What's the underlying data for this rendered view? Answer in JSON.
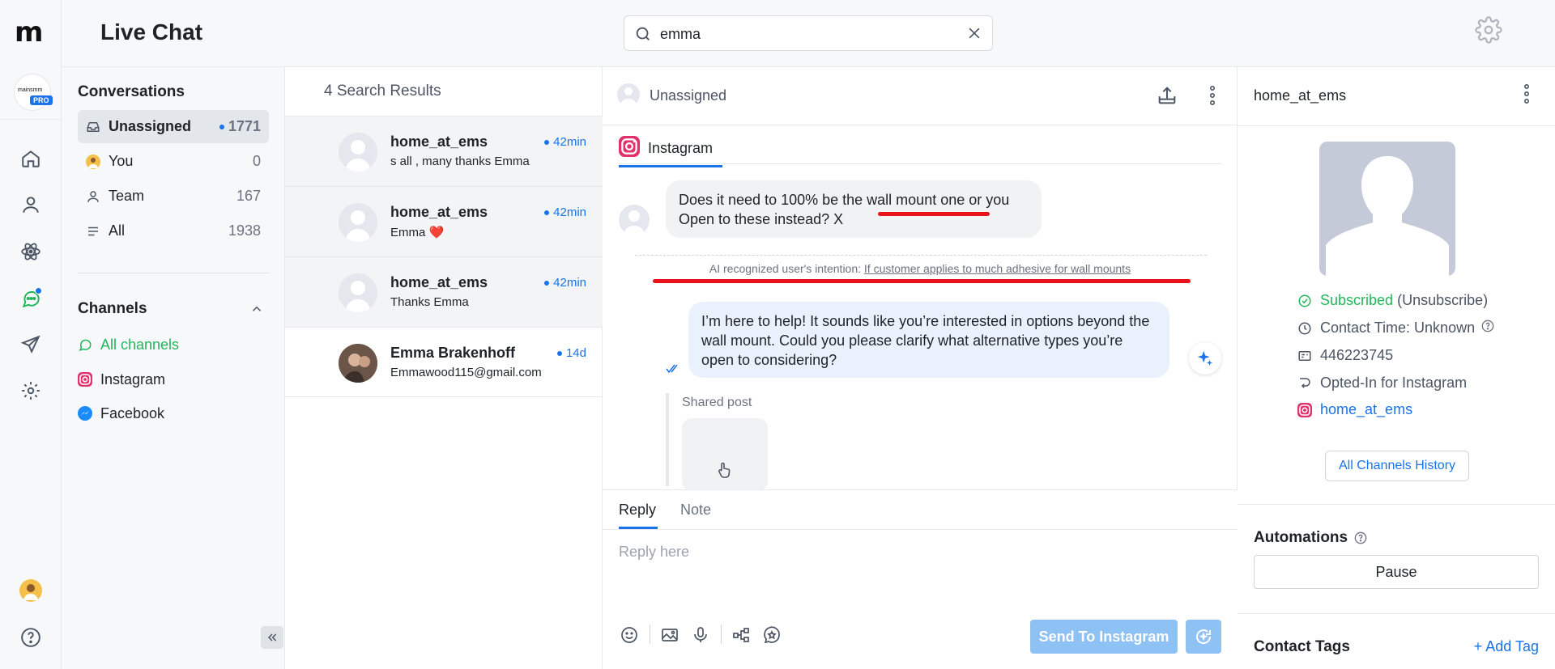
{
  "app": {
    "page_title": "Live Chat",
    "logo_text": "m",
    "account_small_text": "mainsmm",
    "plan_badge": "PRO"
  },
  "search": {
    "value": "emma",
    "placeholder": "Search"
  },
  "sidebar": {
    "conversations_title": "Conversations",
    "items": [
      {
        "label": "Unassigned",
        "count": "1771",
        "icon": "inbox-icon"
      },
      {
        "label": "You",
        "count": "0",
        "icon": "avatar"
      },
      {
        "label": "Team",
        "count": "167",
        "icon": "person-icon"
      },
      {
        "label": "All",
        "count": "1938",
        "icon": "list-icon"
      }
    ],
    "channels_title": "Channels",
    "channels": [
      {
        "label": "All channels",
        "icon": "chat-icon"
      },
      {
        "label": "Instagram",
        "icon": "instagram-icon"
      },
      {
        "label": "Facebook",
        "icon": "messenger-icon"
      }
    ]
  },
  "results": {
    "title": "4 Search Results",
    "items": [
      {
        "name": "home_at_ems",
        "time": "42min",
        "preview": "s all , many thanks Emma"
      },
      {
        "name": "home_at_ems",
        "time": "42min",
        "preview": "Emma ❤️"
      },
      {
        "name": "home_at_ems",
        "time": "42min",
        "preview": "Thanks Emma"
      },
      {
        "name": "Emma Brakenhoff",
        "time": "14d",
        "preview": "Emmawood115@gmail.com"
      }
    ]
  },
  "chat": {
    "assignee": "Unassigned",
    "channel_tab": "Instagram",
    "incoming_line1": "Does it need to 100% be the wall mount one or you",
    "incoming_line2": "Open to these instead? X",
    "ai_intent_prefix": "AI recognized user's intention: ",
    "ai_intent_value": "If customer applies to much adhesive for wall mounts",
    "outgoing_message": "I’m here to help! It sounds like you’re interested in options beyond the wall mount. Could you please clarify what alternative types you’re open to considering?",
    "shared_post_label": "Shared post",
    "reply_tab": "Reply",
    "note_tab": "Note",
    "reply_placeholder": "Reply here",
    "send_button": "Send To Instagram",
    "annotation_color": "#e8141a"
  },
  "contact": {
    "name": "home_at_ems",
    "status": "Subscribed",
    "unsubscribe": "(Unsubscribe)",
    "contact_time": "Contact Time: Unknown",
    "id": "446223745",
    "opt_in": "Opted-In for Instagram",
    "handle": "home_at_ems",
    "history_button": "All Channels History",
    "automations_title": "Automations",
    "pause_button": "Pause",
    "tags_title": "Contact Tags",
    "add_tag": "+ Add Tag"
  },
  "colors": {
    "accent": "#1a73e8",
    "success": "#22b65a",
    "send_disabled": "#8ec2f5"
  }
}
